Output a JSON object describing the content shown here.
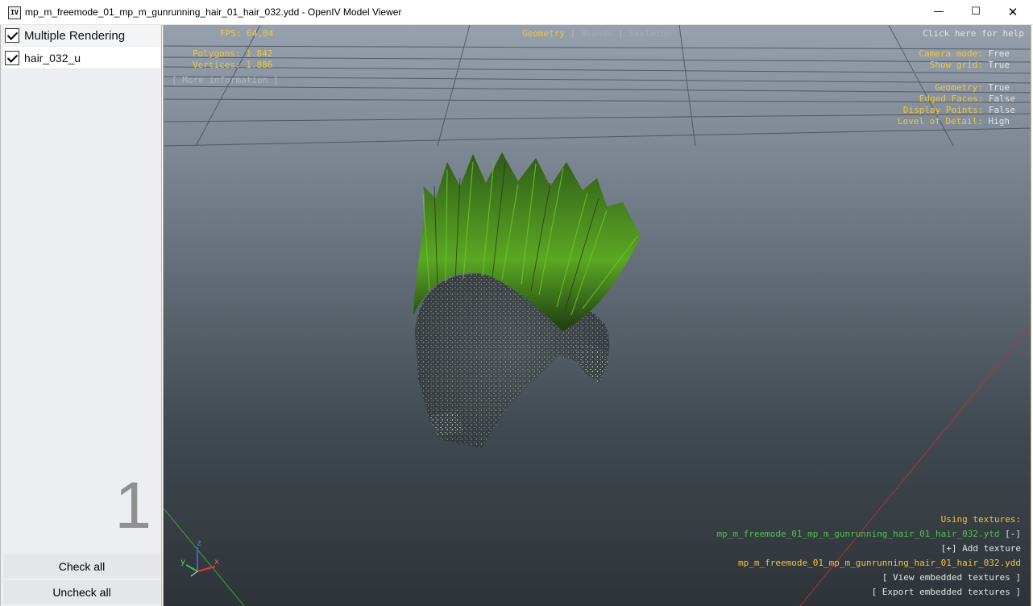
{
  "window": {
    "app_icon": "IV",
    "title": "mp_m_freemode_01_mp_m_gunrunning_hair_01_hair_032.ydd - OpenIV Model Viewer",
    "minimize": "—",
    "maximize": "☐",
    "close": "✕"
  },
  "sidebar": {
    "header_label": "Multiple Rendering",
    "items": [
      {
        "label": "hair_032_u",
        "checked": true
      }
    ],
    "count": "1",
    "check_all": "Check all",
    "uncheck_all": "Uncheck all"
  },
  "hud": {
    "fps_label": "FPS:",
    "fps_value": "64,04",
    "tabs": {
      "geometry": "Geometry",
      "sep": "|",
      "bounds": "Bounds",
      "skeleton": "Skeleton"
    },
    "help": "Click here for help",
    "polygons_label": "Polygons:",
    "polygons_value": "1.842",
    "vertices_label": "Vertices:",
    "vertices_value": "1.886",
    "more_info": "[ More information ]",
    "camera_label": "Camera mode:",
    "camera_value": "Free",
    "grid_label": "Show grid:",
    "grid_value": "True",
    "geometry_label": "Geometry:",
    "geometry_value": "True",
    "edged_label": "Edged Faces:",
    "edged_value": "False",
    "points_label": "Display Points:",
    "points_value": "False",
    "lod_label": "Level of Detail:",
    "lod_value": "High",
    "using_textures": "Using textures:",
    "texture_file": "mp_m_freemode_01_mp_m_gunrunning_hair_01_hair_032.ytd",
    "texture_remove": "[-]",
    "add_texture": "[+] Add texture",
    "model_file": "mp_m_freemode_01_mp_m_gunrunning_hair_01_hair_032.ydd",
    "view_embedded": "[ View embedded textures ]",
    "export_embedded": "[ Export embedded textures ]",
    "axis_x": "x",
    "axis_y": "y",
    "axis_z": "z"
  },
  "colors": {
    "hud_label": "#f0c63a",
    "hud_value": "#e3e3e3",
    "texture_ok": "#52c34b",
    "hair_green": "#4f9a1f",
    "axis_x": "#e23b3b",
    "axis_y": "#3fbf3f",
    "axis_z": "#3b5fe2"
  }
}
